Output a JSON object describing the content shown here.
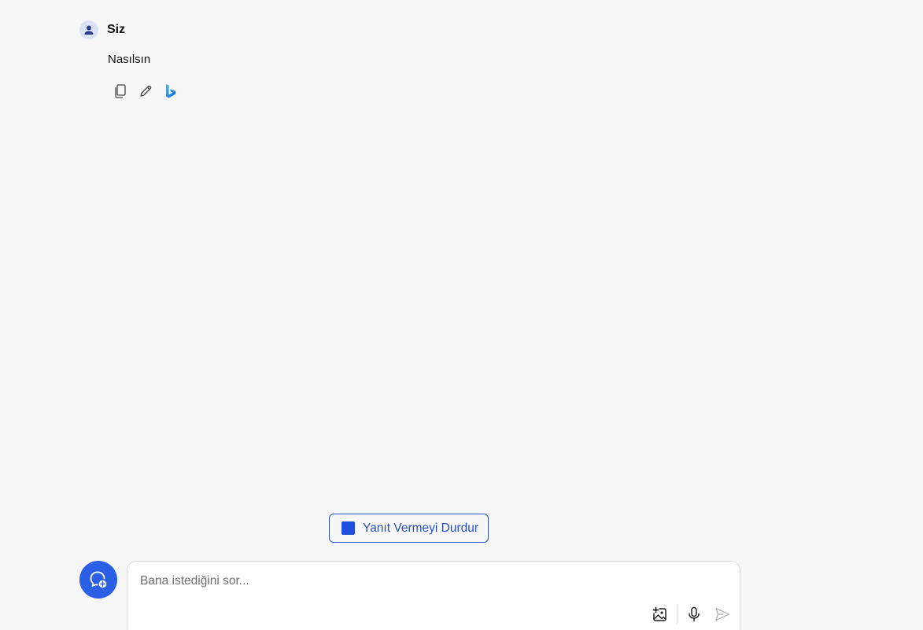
{
  "message": {
    "sender": "Siz",
    "text": "Nasılsın",
    "actions": [
      "copy-icon",
      "edit-icon",
      "bing-icon"
    ]
  },
  "stop_button": {
    "label": "Yanıt Vermeyi Durdur"
  },
  "composer": {
    "placeholder": "Bana istediğini sor...",
    "value": "",
    "tools": [
      "add-image-icon",
      "microphone-icon",
      "send-icon"
    ]
  },
  "colors": {
    "background": "#f7f7f7",
    "accent": "#2a5fe6",
    "stop_square": "#1f4fe0",
    "stop_text": "#2a4fc4",
    "avatar_bg": "#dde3f6"
  }
}
